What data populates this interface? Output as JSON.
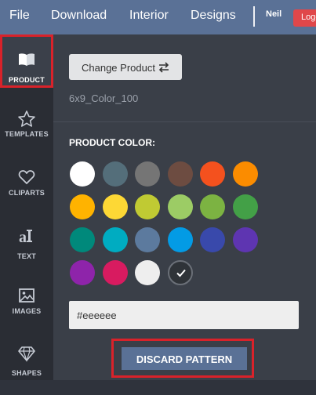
{
  "topbar": {
    "menu": [
      "File",
      "Download",
      "Interior",
      "Designs"
    ],
    "user": "Neil",
    "logout_label": "Logout"
  },
  "sidebar": {
    "items": [
      {
        "label": "PRODUCT",
        "icon": "book-icon",
        "active": true
      },
      {
        "label": "TEMPLATES",
        "icon": "star-icon",
        "active": false
      },
      {
        "label": "CLIPARTS",
        "icon": "heart-icon",
        "active": false
      },
      {
        "label": "TEXT",
        "icon": "text-icon",
        "active": false
      },
      {
        "label": "IMAGES",
        "icon": "image-icon",
        "active": false
      },
      {
        "label": "SHAPES",
        "icon": "diamond-icon",
        "active": false
      }
    ]
  },
  "product": {
    "change_label": "Change Product",
    "change_icon": "swap-arrows-icon",
    "name": "6x9_Color_100"
  },
  "color": {
    "title": "PRODUCT COLOR:",
    "selected": "#eeeeee",
    "swatches": [
      "#ffffff",
      "#546e7a",
      "#757575",
      "#6d4c41",
      "#f4511e",
      "#fb8c00",
      "#ffb300",
      "#fdd835",
      "#c0ca33",
      "#9ccc65",
      "#7cb342",
      "#43a047",
      "#00897b",
      "#00acc1",
      "#5c7a9e",
      "#039be5",
      "#3949ab",
      "#5e35b1",
      "#8e24aa",
      "#d81b60",
      "#eeeeee",
      "#2f3338"
    ],
    "checked_index": 21
  },
  "discard_label": "DISCARD PATTERN"
}
